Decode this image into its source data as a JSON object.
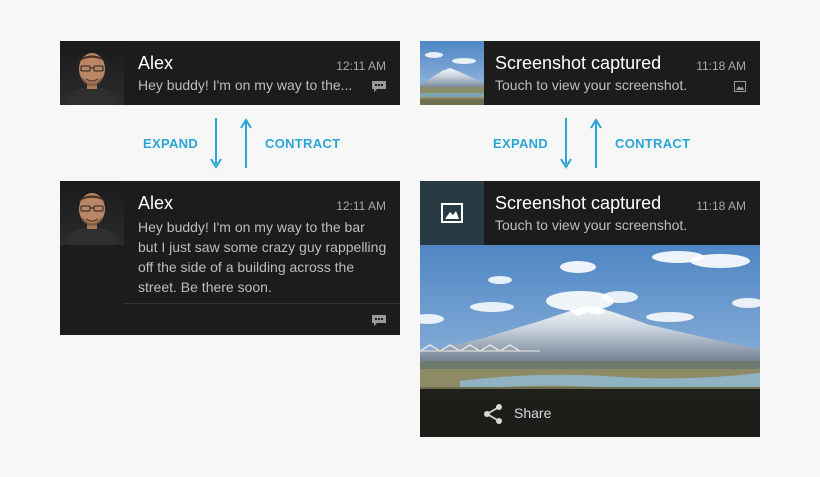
{
  "colors": {
    "accent": "#2aa6d6",
    "card": "#1c1c1c",
    "page": "#f7f7f7",
    "icon_tile": "#283b44"
  },
  "left": {
    "collapsed": {
      "title": "Alex",
      "time": "12:11 AM",
      "text": "Hey buddy! I'm on my way to the...",
      "icon": "message-icon"
    },
    "expanded": {
      "title": "Alex",
      "time": "12:11 AM",
      "text": "Hey buddy! I'm on my way to the bar\nbut I just saw some crazy guy rappelling\noff the side of a building across the\nstreet. Be there soon.",
      "icon": "message-icon"
    },
    "expand_label": "EXPAND",
    "contract_label": "CONTRACT"
  },
  "right": {
    "collapsed": {
      "title": "Screenshot captured",
      "time": "11:18 AM",
      "text": "Touch to view your screenshot.",
      "icon": "image-icon"
    },
    "expanded": {
      "title": "Screenshot captured",
      "time": "11:18 AM",
      "text": "Touch to view your screenshot.",
      "icon": "image-icon",
      "action_label": "Share",
      "action_icon": "share-icon"
    },
    "expand_label": "EXPAND",
    "contract_label": "CONTRACT"
  }
}
